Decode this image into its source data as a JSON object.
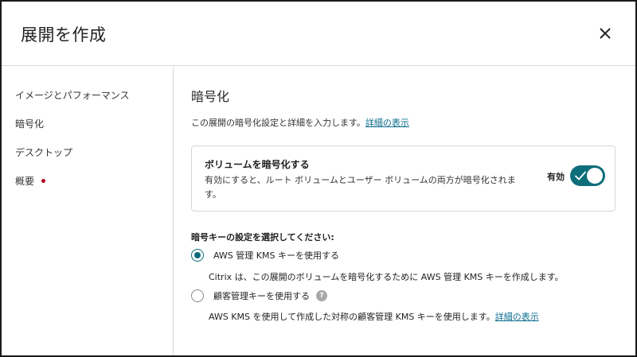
{
  "dialog": {
    "title": "展開を作成"
  },
  "sidebar": {
    "items": [
      {
        "label": "イメージとパフォーマンス"
      },
      {
        "label": "暗号化"
      },
      {
        "label": "デスクトップ"
      },
      {
        "label": "概要"
      }
    ]
  },
  "main": {
    "title": "暗号化",
    "description": "この展開の暗号化設定と詳細を入力します。",
    "details_link": "詳細の表示",
    "card": {
      "title": "ボリュームを暗号化する",
      "description": "有効にすると、ルート ボリュームとユーザー ボリュームの両方が暗号化されます。",
      "toggle_label": "有効",
      "toggle_on": true
    },
    "key_heading": "暗号キーの設定を選択してください:",
    "options": [
      {
        "label": "AWS 管理 KMS キーを使用する",
        "description": "Citrix は、この展開のボリュームを暗号化するために AWS 管理 KMS キーを作成します。",
        "selected": true
      },
      {
        "label": "顧客管理キーを使用する",
        "description": "AWS KMS を使用して作成した対称の顧客管理 KMS キーを使用します。",
        "link": "詳細の表示",
        "selected": false
      }
    ],
    "help_glyph": "?"
  },
  "colors": {
    "accent": "#0d6e7a",
    "link": "#0b6d8e",
    "alert_dot": "#b3001b"
  }
}
